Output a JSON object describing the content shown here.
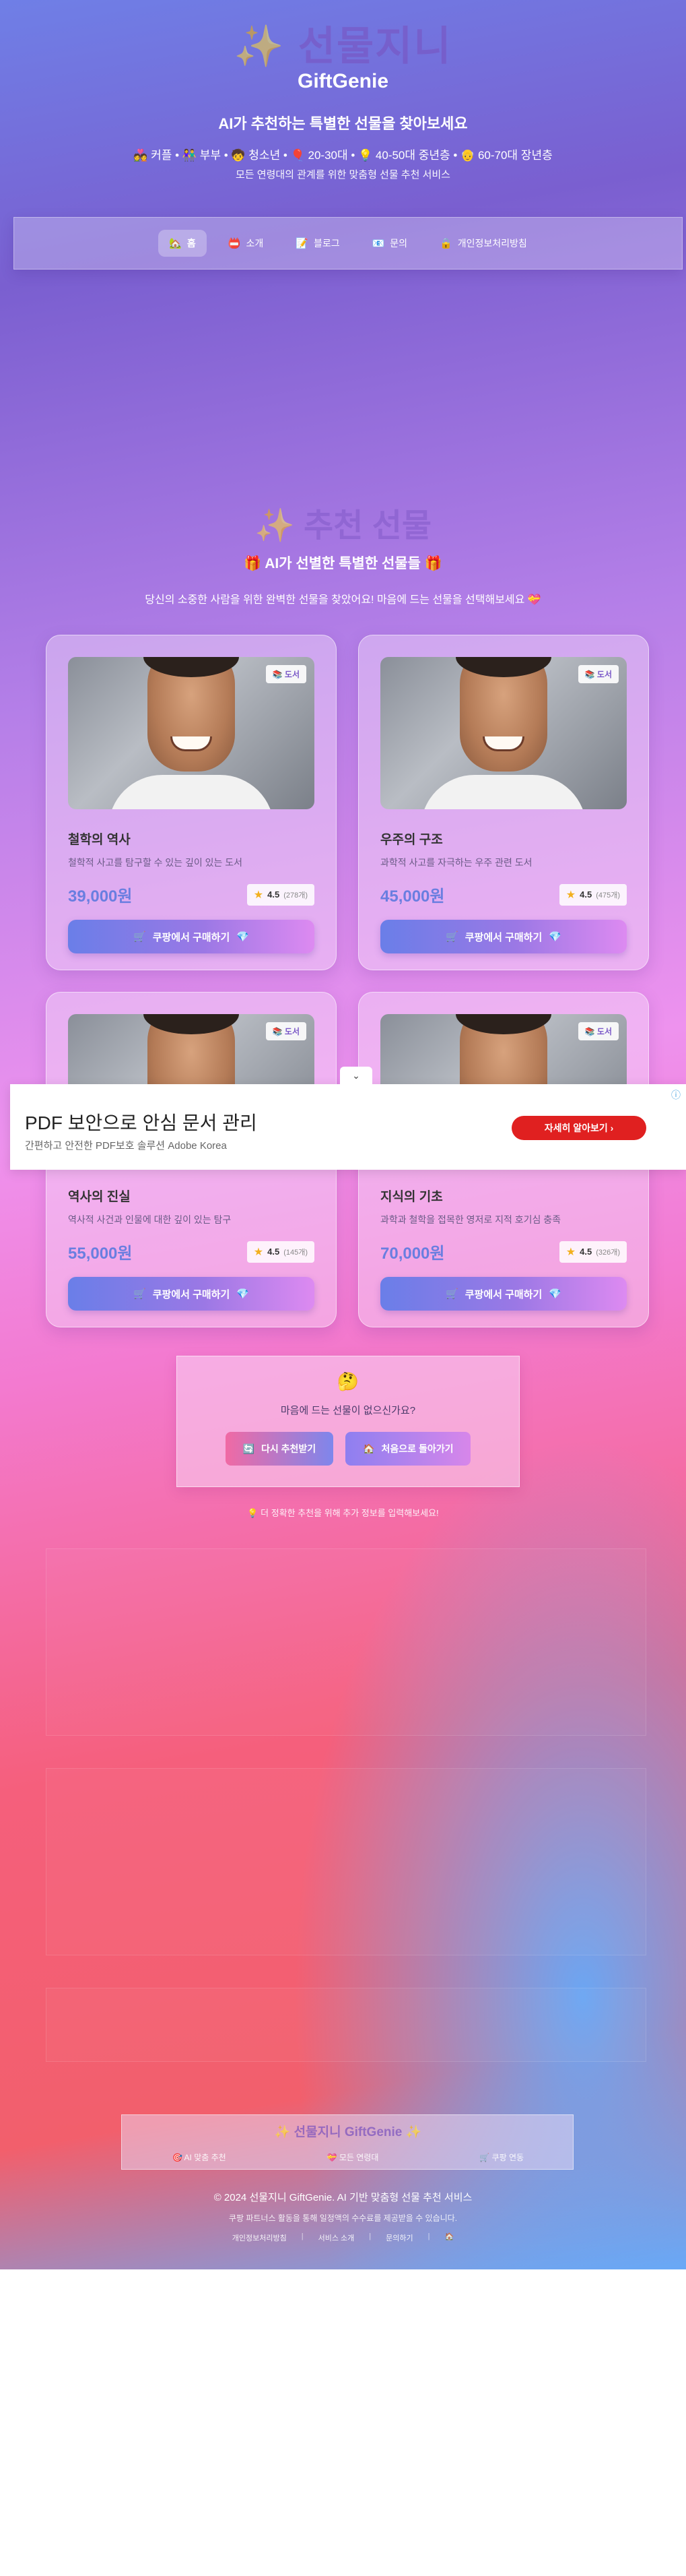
{
  "header": {
    "hero_title": "✨ 선물지니",
    "brand": "GiftGenie",
    "tagline": "AI가 추천하는 특별한 선물을 찾아보세요",
    "audiences": "💑 커플 • 👫 부부 • 🧒 청소년 • 🎈 20-30대 • 💡 40-50대 중년층 • 👴 60-70대 장년층",
    "subtag": "모든 연령대의 관계를 위한 맞춤형 선물 추천 서비스"
  },
  "nav": {
    "items": [
      {
        "icon": "🏡",
        "label": "홈"
      },
      {
        "icon": "📛",
        "label": "소개"
      },
      {
        "icon": "📝",
        "label": "블로그"
      },
      {
        "icon": "📧",
        "label": "문의"
      },
      {
        "icon": "🔒",
        "label": "개인정보처리방침"
      }
    ]
  },
  "section": {
    "title": "✨ 추천 선물",
    "subtitle": "🎁 AI가 선별한 특별한 선물들 🎁",
    "desc": "당신의 소중한 사람을 위한 완벽한 선물을 찾았어요! 마음에 드는 선물을 선택해보세요 💝"
  },
  "cards": [
    {
      "badge": "📚 도서",
      "title": "철학의 역사",
      "desc": "철학적 사고를 탐구할 수 있는 깊이 있는 도서",
      "price": "39,000원",
      "rating": "4.5",
      "count": "(278개)",
      "buy_label": "쿠팡에서 구매하기"
    },
    {
      "badge": "📚 도서",
      "title": "우주의 구조",
      "desc": "과학적 사고를 자극하는 우주 관련 도서",
      "price": "45,000원",
      "rating": "4.5",
      "count": "(475개)",
      "buy_label": "쿠팡에서 구매하기"
    },
    {
      "badge": "📚 도서",
      "title": "역사의 진실",
      "desc": "역사적 사건과 인물에 대한 깊이 있는 탐구",
      "price": "55,000원",
      "rating": "4.5",
      "count": "(145개)",
      "buy_label": "쿠팡에서 구매하기"
    },
    {
      "badge": "📚 도서",
      "title": "지식의 기초",
      "desc": "과학과 철학을 접목한 영저로 지적 호기심 충족",
      "price": "70,000원",
      "rating": "4.5",
      "count": "(326개)",
      "buy_label": "쿠팡에서 구매하기"
    }
  ],
  "ad": {
    "title": "PDF 보안으로 안심 문서 관리",
    "sub": "간편하고 안전한 PDF보호 솔루션 Adobe Korea",
    "button": "자세히 알아보기 ›"
  },
  "retry": {
    "emoji": "🤔",
    "question": "마음에 드는 선물이 없으신가요?",
    "retry_label": "다시 추천받기",
    "restart_label": "처음으로 돌아가기",
    "hint": "💡 더 정확한 추천을 위해 추가 정보를 입력해보세요!"
  },
  "footer": {
    "title": "✨ 선물지니 GiftGenie ✨",
    "features": [
      "🎯 AI 맞춤 추천",
      "💝 모든 연령대",
      "🛒 쿠팡 연동"
    ],
    "copyright": "© 2024 선물지니 GiftGenie. AI 기반 맞춤형 선물 추천 서비스",
    "disclaimer": "쿠팡 파트너스 활동을 통해 일정액의 수수료를 제공받을 수 있습니다.",
    "links": [
      "개인정보처리방침",
      "서비스 소개",
      "문의하기",
      "🏠"
    ]
  }
}
